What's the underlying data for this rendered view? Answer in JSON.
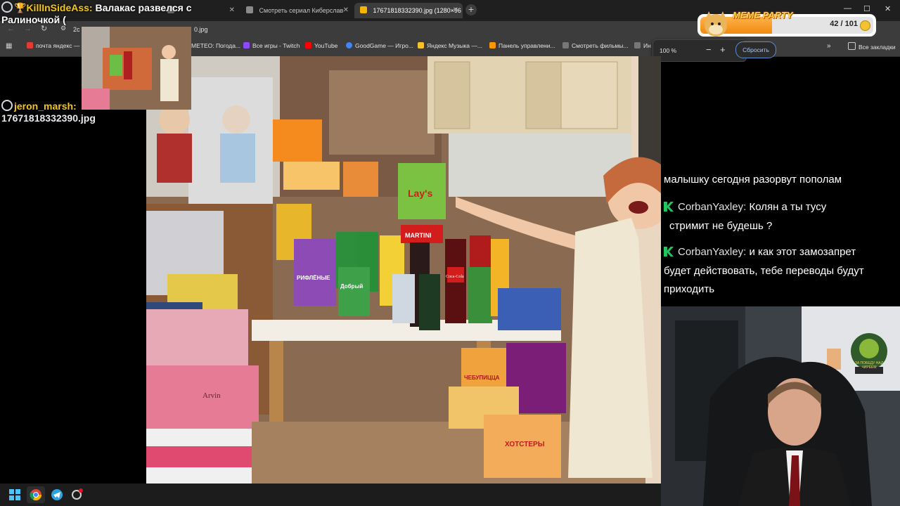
{
  "browser": {
    "tabs": [
      {
        "label": "",
        "active": false
      },
      {
        "label": "Смотреть сериал Киберслав",
        "active": false
      },
      {
        "label": "17671818332390.jpg (1280×96",
        "active": true
      }
    ],
    "partial_url": "2c",
    "partial_url_tail": "0.jpg",
    "bookmarks": [
      "почта яндекс —",
      "METEO: Погода...",
      "Все игры - Twitch",
      "YouTube",
      "GoodGame — Игро...",
      "Яндекс Музыка —...",
      "Панель управлени...",
      "Смотреть фильмы...",
      "Ин"
    ],
    "all_bookmarks": "Все закладки",
    "zoom": {
      "value": "100 %",
      "minus": "−",
      "plus": "+",
      "reset": "Сбросить"
    },
    "more": "»"
  },
  "alert_top": {
    "nick": "KillInSideAss:",
    "text_line1": "Валакас развелся с",
    "text_line2": "Ралиночкой ("
  },
  "alert_bottom": {
    "nick": "jeron_marsh:",
    "text": "17671818332390.jpg"
  },
  "chat": [
    {
      "nick": "",
      "text": "малышку сегодня разорвут пополам"
    },
    {
      "nick": "CorbanYaxley:",
      "text": "Колян а ты тусу"
    },
    {
      "nick": "",
      "text": "стримит не будешь ?"
    },
    {
      "nick": "CorbanYaxley:",
      "text": "и как этот замозапрет"
    },
    {
      "nick": "",
      "text": "будет действовать, тебе переводы будут"
    },
    {
      "nick": "",
      "text": "приходить"
    }
  ],
  "meme_party": {
    "title": "MEME PARTY",
    "count": "42 / 101",
    "progress": 0.416
  },
  "photo_labels": {
    "brand1": "Lay's",
    "brand2": "MARTINI",
    "brand3": "Coca-Cola",
    "pack1": "РИФЛЁНЫЕ",
    "pack2": "ЧЕБУПИЦЦА",
    "pack3": "ХОТСТЕРЫ",
    "pack4": "Добрый",
    "box": "Arvin"
  },
  "badge": {
    "text": "ЗА ПОБЕДУ НАД ЧИРЕЕМ"
  },
  "colors": {
    "accent": "#f08a10",
    "chrome_dark": "#1f1f1f",
    "chrome": "#3c3c3c",
    "link": "#a8c7fa"
  }
}
